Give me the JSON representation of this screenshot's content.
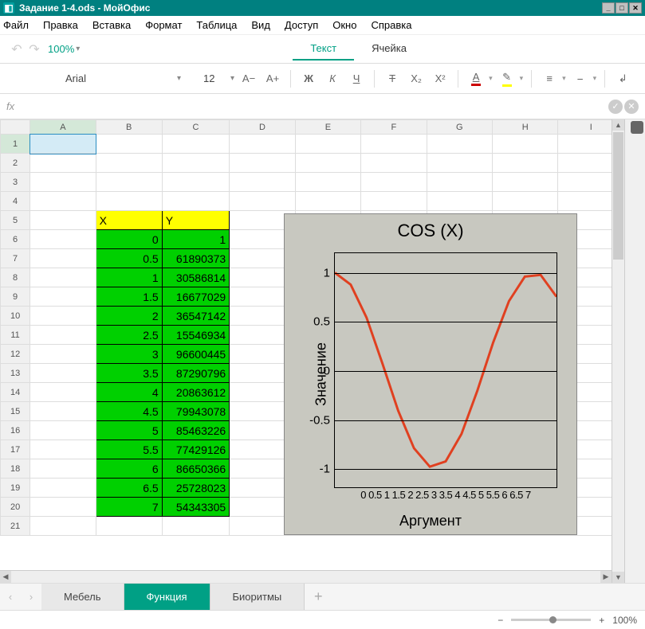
{
  "window": {
    "title": "Задание 1-4.ods - МойОфис"
  },
  "menu": [
    "Файл",
    "Правка",
    "Вставка",
    "Формат",
    "Таблица",
    "Вид",
    "Доступ",
    "Окно",
    "Справка"
  ],
  "toolbar": {
    "zoom": "100%"
  },
  "ctxtabs": {
    "text": "Текст",
    "cell": "Ячейка"
  },
  "format": {
    "font": "Arial",
    "size": "12"
  },
  "fx": {
    "label": "fx"
  },
  "cols": [
    "A",
    "B",
    "C",
    "D",
    "E",
    "F",
    "G",
    "H",
    "I"
  ],
  "rows": 21,
  "table": {
    "headers": {
      "x": "X",
      "y": "Y"
    },
    "data": [
      {
        "row": 5,
        "x": "",
        "y": ""
      },
      {
        "row": 6,
        "x": "0",
        "y": "1"
      },
      {
        "row": 7,
        "x": "0.5",
        "y": "61890373"
      },
      {
        "row": 8,
        "x": "1",
        "y": "30586814"
      },
      {
        "row": 9,
        "x": "1.5",
        "y": "16677029"
      },
      {
        "row": 10,
        "x": "2",
        "y": "36547142"
      },
      {
        "row": 11,
        "x": "2.5",
        "y": "15546934"
      },
      {
        "row": 12,
        "x": "3",
        "y": "96600445"
      },
      {
        "row": 13,
        "x": "3.5",
        "y": "87290796"
      },
      {
        "row": 14,
        "x": "4",
        "y": "20863612"
      },
      {
        "row": 15,
        "x": "4.5",
        "y": "79943078"
      },
      {
        "row": 16,
        "x": "5",
        "y": "85463226"
      },
      {
        "row": 17,
        "x": "5.5",
        "y": "77429126"
      },
      {
        "row": 18,
        "x": "6",
        "y": "86650366"
      },
      {
        "row": 19,
        "x": "6.5",
        "y": "25728023"
      },
      {
        "row": 20,
        "x": "7",
        "y": "54343305"
      }
    ]
  },
  "chart_data": {
    "type": "line",
    "title": "COS (X)",
    "xlabel": "Аргумент",
    "ylabel": "Значение",
    "x": [
      0,
      0.5,
      1,
      1.5,
      2,
      2.5,
      3,
      3.5,
      4,
      4.5,
      5,
      5.5,
      6,
      6.5,
      7
    ],
    "y": [
      1,
      0.878,
      0.54,
      0.071,
      -0.416,
      -0.801,
      -0.99,
      -0.936,
      -0.654,
      -0.211,
      0.284,
      0.709,
      0.96,
      0.977,
      0.754
    ],
    "yticks": [
      -1,
      -0.5,
      0,
      0.5,
      1
    ],
    "xticks": [
      0,
      0.5,
      1,
      1.5,
      2,
      2.5,
      3,
      3.5,
      4,
      4.5,
      5,
      5.5,
      6,
      6.5,
      7
    ],
    "ylim": [
      -1.2,
      1.2
    ],
    "xlim": [
      0,
      7
    ]
  },
  "sheets": {
    "items": [
      "Мебель",
      "Функция",
      "Биоритмы"
    ],
    "active": 1
  },
  "status": {
    "zoom": "100%"
  }
}
